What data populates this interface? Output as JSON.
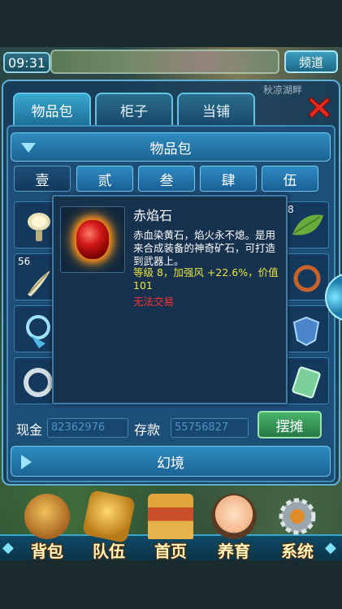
{
  "topbar": {
    "time": "09:31",
    "channel_label": "频道"
  },
  "location_text": "秋凉湖畔",
  "tabs": [
    {
      "label": "物品包",
      "active": true
    },
    {
      "label": "柜子",
      "active": false
    },
    {
      "label": "当铺",
      "active": false
    }
  ],
  "inventory": {
    "header": "物品包",
    "pages": [
      "壹",
      "贰",
      "叁",
      "肆",
      "伍"
    ],
    "selected_page": 0,
    "slot_counts": {
      "slot_r2c1": "56",
      "slot_r1c6": "8"
    }
  },
  "money": {
    "cash_label": "现金",
    "cash_value": "82362976",
    "deposit_label": "存款",
    "deposit_value": "55756827"
  },
  "stall_button": "摆摊",
  "dream_label": "幻境",
  "tooltip": {
    "name": "赤焰石",
    "description": "赤血染黄石，焰火永不熄。是用来合成装备的神奇矿石，可打造到武器上。",
    "stats": "等级 8，加强风 +22.6%，价值 101",
    "untradable": "无法交易"
  },
  "dock": [
    {
      "label": "背包",
      "icon": "bag-icon"
    },
    {
      "label": "队伍",
      "icon": "team-icon"
    },
    {
      "label": "首页",
      "icon": "home-icon"
    },
    {
      "label": "养育",
      "icon": "child-icon"
    },
    {
      "label": "系统",
      "icon": "gear-icon"
    }
  ],
  "colors": {
    "panel_bg": "#173c5c",
    "accent_blue": "#2f8cc0",
    "stat_yellow": "#e7e53b",
    "untradable_red": "#ff3030",
    "stall_green": "#47b26a"
  }
}
